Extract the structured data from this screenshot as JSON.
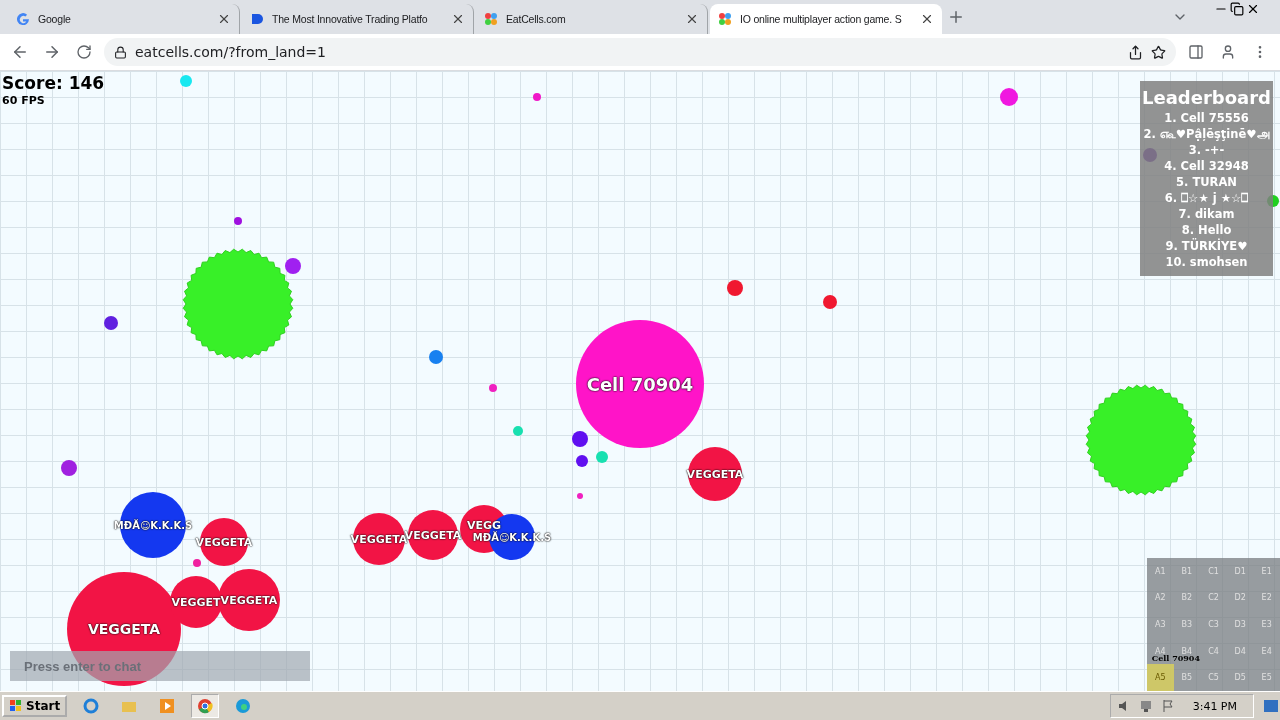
{
  "browser": {
    "tabs": [
      {
        "title": "Google",
        "selected": false
      },
      {
        "title": "The Most Innovative Trading Platfo",
        "selected": false
      },
      {
        "title": "EatCells.com",
        "selected": false
      },
      {
        "title": "IO online multiplayer action game. S",
        "selected": true
      }
    ],
    "url": "eatcells.com/?from_land=1"
  },
  "game": {
    "score": "Score: 146",
    "fps": "60 FPS",
    "leaderboard": {
      "title": "Leaderboard",
      "entries": [
        "1. Cell 75556",
        "2. ௷♥Pậļēşţinē♥அ",
        "3. -+-",
        "4. Cell 32948",
        "5. TURAN",
        "6. ⎕☆★ j ★☆⎕",
        "7. dikam",
        "8. Hello",
        "9. TÜRKİYE♥",
        "10. smohsen"
      ]
    },
    "cells": [
      {
        "name": "Cell 70904",
        "color": "#ff14c8"
      },
      {
        "name": "VEGGETA",
        "color": "#f21445"
      },
      {
        "name": "VEGGETA",
        "color": "#f21445"
      },
      {
        "name": "VEGGET",
        "color": "#f21445"
      },
      {
        "name": "VEGGETA",
        "color": "#f21445"
      },
      {
        "name": "VEGGETA",
        "color": "#f21445"
      },
      {
        "name": "MĐĂ☺K.K.K.S",
        "color": "#1438f0"
      },
      {
        "name": "VEGGETA",
        "color": "#f21445"
      },
      {
        "name": "VEGGETA",
        "color": "#f21445"
      },
      {
        "name": "VEGG",
        "color": "#f21445"
      },
      {
        "name": "MĐĂ☺K.K.K.S",
        "color": "#1438f0"
      }
    ],
    "chat": {
      "placeholder": "Press enter to chat"
    },
    "minimap": {
      "sectors": [
        {
          "label": "A1",
          "selected": false
        },
        {
          "label": "B1",
          "selected": false
        },
        {
          "label": "C1",
          "selected": false
        },
        {
          "label": "D1",
          "selected": false
        },
        {
          "label": "E1",
          "selected": false
        },
        {
          "label": "A2",
          "selected": false
        },
        {
          "label": "B2",
          "selected": false
        },
        {
          "label": "C2",
          "selected": false
        },
        {
          "label": "D2",
          "selected": false
        },
        {
          "label": "E2",
          "selected": false
        },
        {
          "label": "A3",
          "selected": false
        },
        {
          "label": "B3",
          "selected": false
        },
        {
          "label": "C3",
          "selected": false
        },
        {
          "label": "D3",
          "selected": false
        },
        {
          "label": "E3",
          "selected": false
        },
        {
          "label": "A4",
          "selected": false
        },
        {
          "label": "B4",
          "selected": false
        },
        {
          "label": "C4",
          "selected": false
        },
        {
          "label": "D4",
          "selected": false
        },
        {
          "label": "E4",
          "selected": false
        },
        {
          "label": "A5",
          "selected": true
        },
        {
          "label": "B5",
          "selected": false
        },
        {
          "label": "C5",
          "selected": false
        },
        {
          "label": "D5",
          "selected": false
        },
        {
          "label": "E5",
          "selected": false
        }
      ],
      "player": "Cell 70904"
    }
  },
  "taskbar": {
    "start": "Start",
    "time": "3:41 PM"
  }
}
